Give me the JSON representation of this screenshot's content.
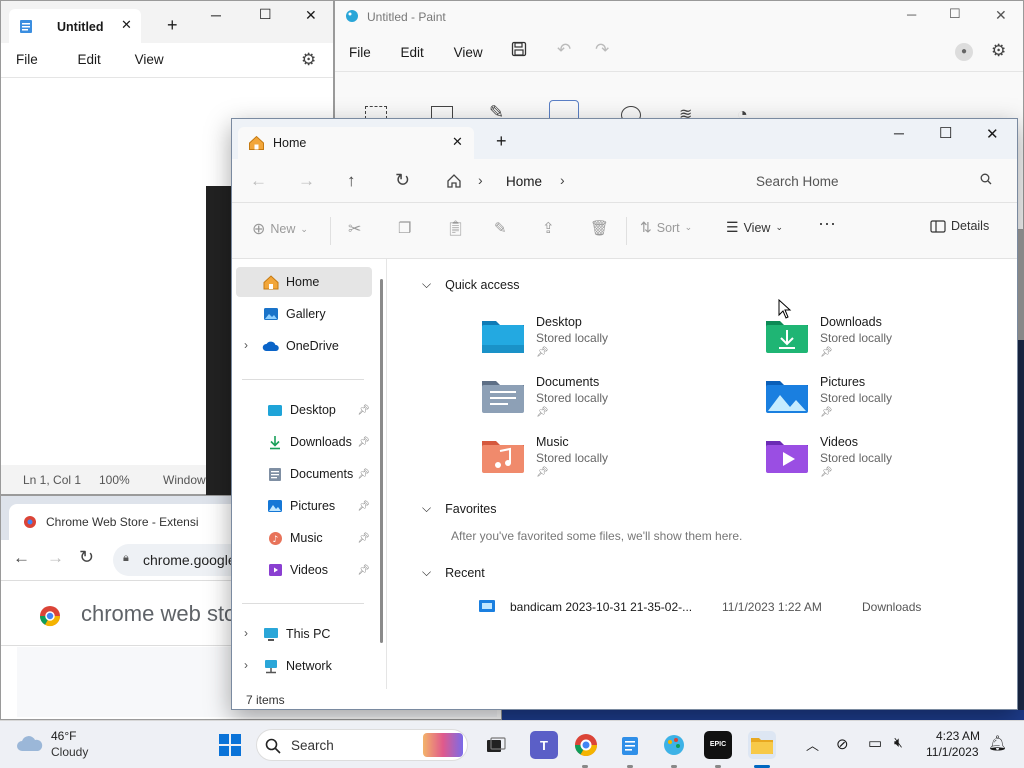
{
  "notepad": {
    "tab_title": "Untitled",
    "menu": [
      "File",
      "Edit",
      "View"
    ],
    "status": {
      "position": "Ln 1, Col 1",
      "zoom": "100%",
      "line_ending": "Window"
    }
  },
  "paint": {
    "title": "Untitled - Paint",
    "menu": [
      "File",
      "Edit",
      "View"
    ]
  },
  "chrome": {
    "tab_title": "Chrome Web Store - Extensi",
    "address": "chrome.google",
    "page_logo_text": "chrome web sto"
  },
  "explorer": {
    "tab_title": "Home",
    "breadcrumb": "Home",
    "search_placeholder": "Search Home",
    "toolbar": {
      "new": "New",
      "sort": "Sort",
      "view": "View",
      "details": "Details"
    },
    "sidebar": {
      "top": [
        "Home",
        "Gallery",
        "OneDrive"
      ],
      "pinned": [
        "Desktop",
        "Downloads",
        "Documents",
        "Pictures",
        "Music",
        "Videos"
      ],
      "bottom": [
        "This PC",
        "Network"
      ]
    },
    "status": "7 items",
    "quick_access": {
      "title": "Quick access",
      "items": [
        {
          "name": "Desktop",
          "sub": "Stored locally"
        },
        {
          "name": "Downloads",
          "sub": "Stored locally"
        },
        {
          "name": "Documents",
          "sub": "Stored locally"
        },
        {
          "name": "Pictures",
          "sub": "Stored locally"
        },
        {
          "name": "Music",
          "sub": "Stored locally"
        },
        {
          "name": "Videos",
          "sub": "Stored locally"
        }
      ]
    },
    "favorites": {
      "title": "Favorites",
      "empty": "After you've favorited some files, we'll show them here."
    },
    "recent": {
      "title": "Recent",
      "items": [
        {
          "name": "bandicam 2023-10-31 21-35-02-...",
          "date": "11/1/2023 1:22 AM",
          "location": "Downloads"
        }
      ]
    }
  },
  "taskbar": {
    "weather": {
      "temp": "46°F",
      "condition": "Cloudy"
    },
    "search": "Search",
    "clock": {
      "time": "4:23 AM",
      "date": "11/1/2023"
    }
  },
  "colors": {
    "accent": "#0067c0",
    "selected": "#e5e5e5"
  }
}
